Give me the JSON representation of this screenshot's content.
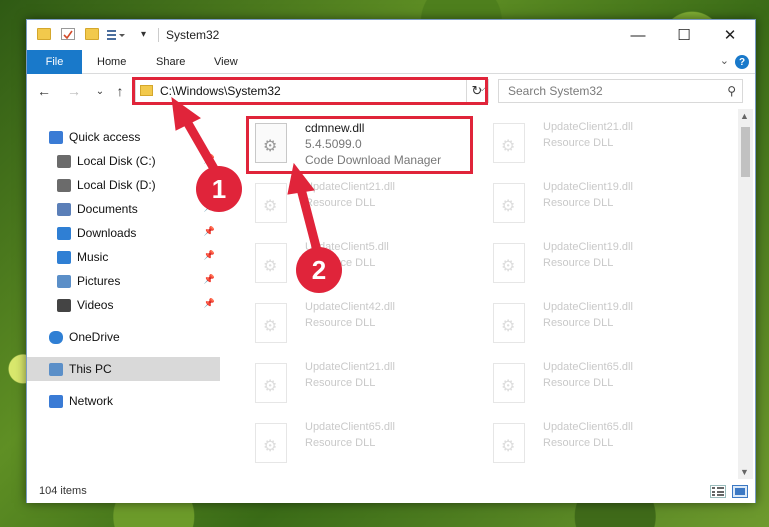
{
  "window": {
    "title": "System32",
    "controls": {
      "minimize": "—",
      "maximize": "☐",
      "close": "✕"
    }
  },
  "ribbon": {
    "file_tab": "File",
    "tabs": [
      "Home",
      "Share",
      "View"
    ],
    "help": "?"
  },
  "nav": {
    "back": "←",
    "forward": "→",
    "recent": "⌄",
    "up": "↑",
    "address": "C:\\Windows\\System32",
    "refresh": "↻",
    "search_placeholder": "Search System32"
  },
  "sidebar": {
    "items": [
      {
        "label": "Quick access",
        "icon": "star-icon",
        "pinned": false
      },
      {
        "label": "Local Disk (C:)",
        "icon": "drive-icon",
        "pinned": true
      },
      {
        "label": "Local Disk (D:)",
        "icon": "drive-icon",
        "pinned": false
      },
      {
        "label": "Documents",
        "icon": "documents-icon",
        "pinned": true
      },
      {
        "label": "Downloads",
        "icon": "downloads-icon",
        "pinned": true
      },
      {
        "label": "Music",
        "icon": "music-icon",
        "pinned": true
      },
      {
        "label": "Pictures",
        "icon": "pictures-icon",
        "pinned": true
      },
      {
        "label": "Videos",
        "icon": "videos-icon",
        "pinned": true
      },
      {
        "label": "OneDrive",
        "icon": "cloud-icon",
        "pinned": false
      },
      {
        "label": "This PC",
        "icon": "computer-icon",
        "pinned": false,
        "selected": true
      },
      {
        "label": "Network",
        "icon": "network-icon",
        "pinned": false
      }
    ]
  },
  "files": {
    "highlighted": {
      "name": "cdmnew.dll",
      "version": "5.4.5099.0",
      "description": "Code Download Manager"
    },
    "left_column": [
      {
        "name": "UpdateClient21.dll",
        "type": "Resource DLL"
      },
      {
        "name": "UpdateClient5.dll",
        "type": "Resource DLL"
      },
      {
        "name": "UpdateClient42.dll",
        "type": "Resource DLL"
      },
      {
        "name": "UpdateClient21.dll",
        "type": "Resource DLL"
      },
      {
        "name": "UpdateClient65.dll",
        "type": "Resource DLL"
      }
    ],
    "right_column": [
      {
        "name": "UpdateClient21.dll",
        "type": "Resource DLL"
      },
      {
        "name": "UpdateClient19.dll",
        "type": "Resource DLL"
      },
      {
        "name": "UpdateClient19.dll",
        "type": "Resource DLL"
      },
      {
        "name": "UpdateClient19.dll",
        "type": "Resource DLL"
      },
      {
        "name": "UpdateClient65.dll",
        "type": "Resource DLL"
      },
      {
        "name": "UpdateClient65.dll",
        "type": "Resource DLL"
      }
    ]
  },
  "status": {
    "item_count": "104 items"
  },
  "annotations": {
    "step1": "1",
    "step2": "2",
    "accent_color": "#e0243a"
  }
}
